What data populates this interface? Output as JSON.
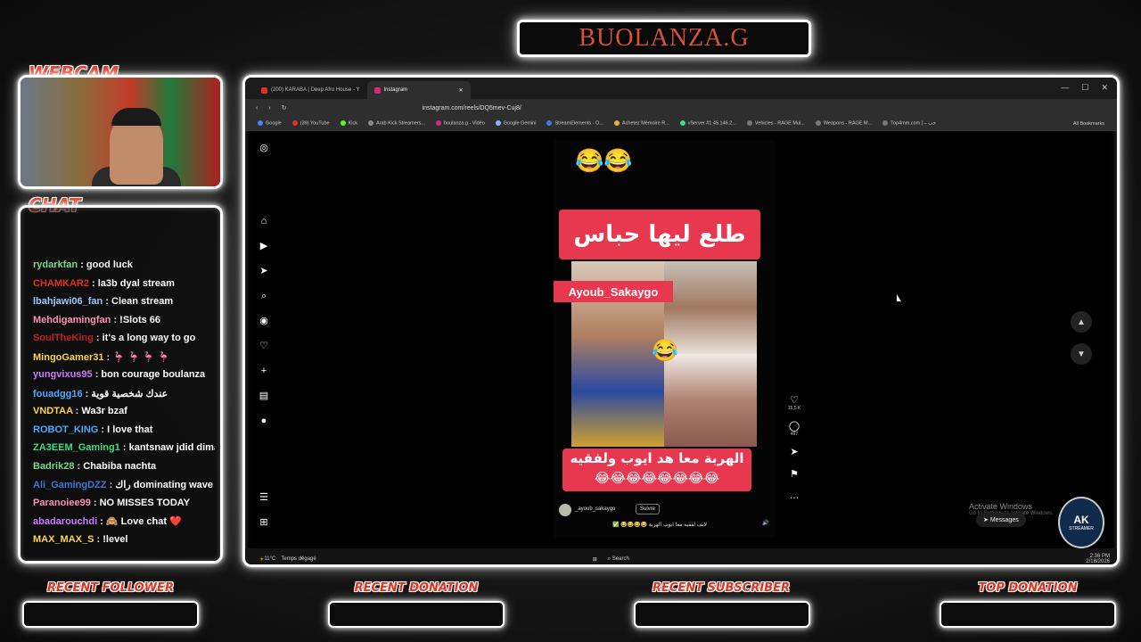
{
  "header": {
    "title": "BUOLANZA.G"
  },
  "webcam": {
    "label": "WEBCAM"
  },
  "chat": {
    "label": "CHAT",
    "messages": [
      {
        "user": "rydarkfan",
        "color": "#7bd88f",
        "text": "good luck"
      },
      {
        "user": "CHAMKAR2",
        "color": "#e0321f",
        "text": "la3b dyal stream"
      },
      {
        "user": "lbahjawi06_fan",
        "color": "#9ec9ff",
        "text": "Clean stream"
      },
      {
        "user": "Mehdigamingfan",
        "color": "#ff8fb0",
        "text": "!Slots 66"
      },
      {
        "user": "SoulTheKing",
        "color": "#c02020",
        "text": "it's a long way to go"
      },
      {
        "user": "MingoGamer31",
        "color": "#ffd54a",
        "text": "🦩 🦩 🦩 🦩"
      },
      {
        "user": "yungvixus95",
        "color": "#c77dff",
        "text": "bon courage boulanza"
      },
      {
        "user": "fouadgg16",
        "color": "#4ea8ff",
        "text": "عندك شخصية قوية"
      },
      {
        "user": "VNDTAA",
        "color": "#ffd54a",
        "text": "Wa3r bzaf"
      },
      {
        "user": "ROBOT_KING",
        "color": "#4ea8ff",
        "text": "I love that"
      },
      {
        "user": "ZA3EEM_Gaming1",
        "color": "#3ddc84",
        "text": "kantsnaw jdid dima"
      },
      {
        "user": "Badrik28",
        "color": "#7bd88f",
        "text": "Chabiba nachta"
      },
      {
        "user": "Ali_GamingDZZ",
        "color": "#3a7bd5",
        "text": "راك dominating wave"
      },
      {
        "user": "Paranoiee99",
        "color": "#ff8fb0",
        "text": "NO MISSES TODAY"
      },
      {
        "user": "abadarouchdi",
        "color": "#c77dff",
        "text": "🙈 Love chat ❤️"
      },
      {
        "user": "MAX_MAX_S",
        "color": "#ffd54a",
        "text": "!level"
      }
    ]
  },
  "browser": {
    "tabs": [
      {
        "label": "(200) KARABA | Deep Afro House - Y",
        "color": "#e0321f"
      },
      {
        "label": "Instagram",
        "color": "#d62976"
      }
    ],
    "url": "instagram.com/reels/DQ5mev-Cuj8/",
    "bookmarks": [
      "Google",
      "(39) YouTube",
      "Kick",
      "Arab Kick Streamers...",
      "boulanza.g - Vidéo",
      "Google Gemini",
      "StreamElements - O...",
      "Achetez Mémoire R...",
      "vServer #1 45.146.2...",
      "Vehicles - RAGE Mul...",
      "Weapons - RAGE M...",
      "Top4mm.com | – حب"
    ],
    "all_bookmarks": "All Bookmarks"
  },
  "reel": {
    "emoji_top": "😂😂",
    "banner": "طلع ليها حباس",
    "name_tag": "Ayoub_Sakaygo",
    "emoji_mid": "😂",
    "caption": "الهربة معا هد ايوب ولفقيه😂😂😂😂😂😂😂😂",
    "username": "_ayoub_sakaygo",
    "follow": "Suivre",
    "description": "لايف لفقيه معا ايوب الهربة 😂😂😂😂 ✅",
    "likes": "15,5 K",
    "comments": "497"
  },
  "windows": {
    "activate": "Activate Windows",
    "activate_sub": "Go to Settings to activate Windows.",
    "messages": "Messages",
    "weather": "11°C",
    "weather_sub": "Temps dégagé",
    "search": "Search",
    "time": "2:36 PM",
    "date": "2/18/2026"
  },
  "logo": {
    "text": "AK",
    "sub": "STREAMER"
  },
  "bottom": {
    "recent_follower": "RECENT FOLLOWER",
    "recent_donation": "RECENT DONATION",
    "recent_subscriber": "RECENT SUBSCRIBER",
    "top_donation": "TOP DONATION"
  }
}
